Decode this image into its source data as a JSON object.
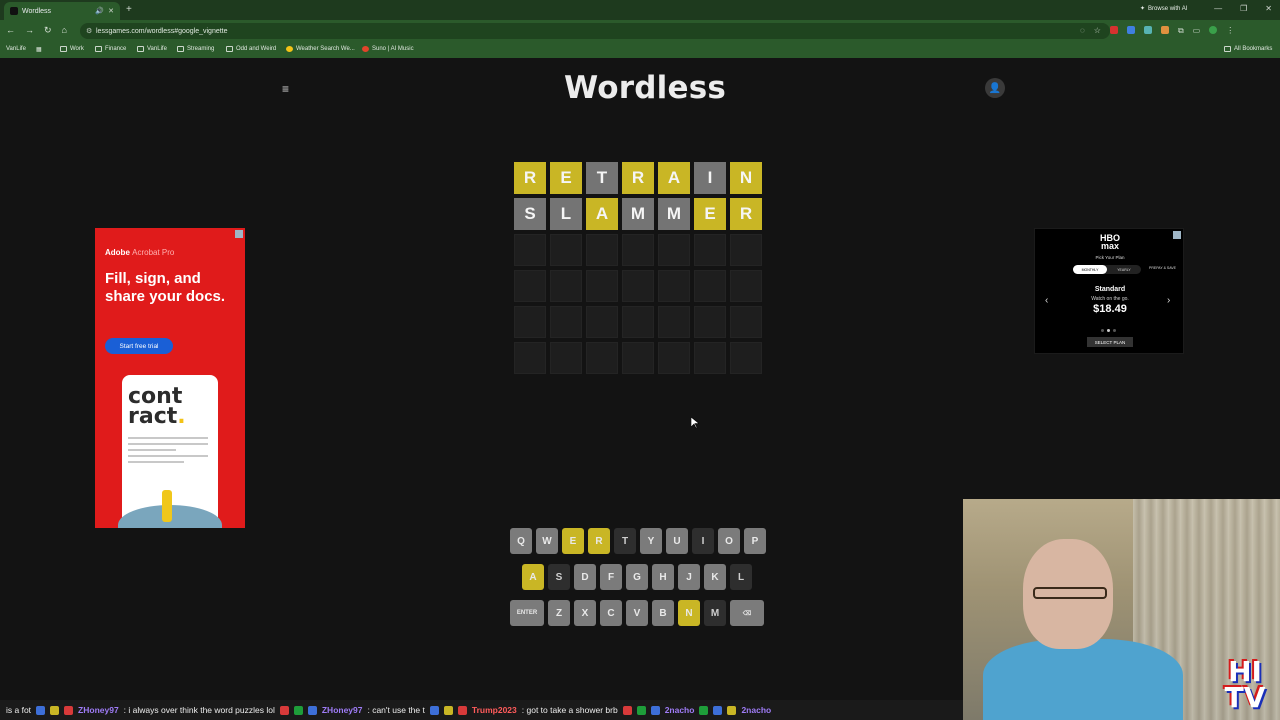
{
  "browser": {
    "tab_title": "Wordless",
    "url": "lessgames.com/wordless#google_vignette",
    "browse_ai": "Browse with AI",
    "bookmarks": [
      "VanLife",
      "Work",
      "Finance",
      "VanLife",
      "Streaming",
      "Odd and Weird",
      "Weather Search We...",
      "Suno | AI Music"
    ],
    "all_bookmarks": "All Bookmarks"
  },
  "game": {
    "title": "Wordless",
    "grid": [
      [
        {
          "l": "R",
          "s": "yellow"
        },
        {
          "l": "E",
          "s": "yellow"
        },
        {
          "l": "T",
          "s": "gray"
        },
        {
          "l": "R",
          "s": "yellow"
        },
        {
          "l": "A",
          "s": "yellow"
        },
        {
          "l": "I",
          "s": "gray"
        },
        {
          "l": "N",
          "s": "yellow"
        }
      ],
      [
        {
          "l": "S",
          "s": "gray"
        },
        {
          "l": "L",
          "s": "gray"
        },
        {
          "l": "A",
          "s": "yellow"
        },
        {
          "l": "M",
          "s": "gray"
        },
        {
          "l": "M",
          "s": "gray"
        },
        {
          "l": "E",
          "s": "yellow"
        },
        {
          "l": "R",
          "s": "yellow"
        }
      ],
      [
        {
          "l": "",
          "s": "empty"
        },
        {
          "l": "",
          "s": "empty"
        },
        {
          "l": "",
          "s": "empty"
        },
        {
          "l": "",
          "s": "empty"
        },
        {
          "l": "",
          "s": "empty"
        },
        {
          "l": "",
          "s": "empty"
        },
        {
          "l": "",
          "s": "empty"
        }
      ],
      [
        {
          "l": "",
          "s": "empty"
        },
        {
          "l": "",
          "s": "empty"
        },
        {
          "l": "",
          "s": "empty"
        },
        {
          "l": "",
          "s": "empty"
        },
        {
          "l": "",
          "s": "empty"
        },
        {
          "l": "",
          "s": "empty"
        },
        {
          "l": "",
          "s": "empty"
        }
      ],
      [
        {
          "l": "",
          "s": "empty"
        },
        {
          "l": "",
          "s": "empty"
        },
        {
          "l": "",
          "s": "empty"
        },
        {
          "l": "",
          "s": "empty"
        },
        {
          "l": "",
          "s": "empty"
        },
        {
          "l": "",
          "s": "empty"
        },
        {
          "l": "",
          "s": "empty"
        }
      ],
      [
        {
          "l": "",
          "s": "empty"
        },
        {
          "l": "",
          "s": "empty"
        },
        {
          "l": "",
          "s": "empty"
        },
        {
          "l": "",
          "s": "empty"
        },
        {
          "l": "",
          "s": "empty"
        },
        {
          "l": "",
          "s": "empty"
        },
        {
          "l": "",
          "s": "empty"
        }
      ]
    ],
    "keyboard": [
      [
        {
          "k": "Q",
          "s": "gray"
        },
        {
          "k": "W",
          "s": "gray"
        },
        {
          "k": "E",
          "s": "yellow"
        },
        {
          "k": "R",
          "s": "yellow"
        },
        {
          "k": "T",
          "s": "dark"
        },
        {
          "k": "Y",
          "s": "gray"
        },
        {
          "k": "U",
          "s": "gray"
        },
        {
          "k": "I",
          "s": "dark"
        },
        {
          "k": "O",
          "s": "gray"
        },
        {
          "k": "P",
          "s": "gray"
        }
      ],
      [
        {
          "k": "A",
          "s": "yellow"
        },
        {
          "k": "S",
          "s": "dark"
        },
        {
          "k": "D",
          "s": "gray"
        },
        {
          "k": "F",
          "s": "gray"
        },
        {
          "k": "G",
          "s": "gray"
        },
        {
          "k": "H",
          "s": "gray"
        },
        {
          "k": "J",
          "s": "gray"
        },
        {
          "k": "K",
          "s": "gray"
        },
        {
          "k": "L",
          "s": "dark"
        }
      ],
      [
        {
          "k": "ENTER",
          "s": "gray",
          "wide": true
        },
        {
          "k": "Z",
          "s": "gray"
        },
        {
          "k": "X",
          "s": "gray"
        },
        {
          "k": "C",
          "s": "gray"
        },
        {
          "k": "V",
          "s": "gray"
        },
        {
          "k": "B",
          "s": "gray"
        },
        {
          "k": "N",
          "s": "yellow"
        },
        {
          "k": "M",
          "s": "dark"
        },
        {
          "k": "⌫",
          "s": "gray",
          "wide": true
        }
      ]
    ]
  },
  "ad_left": {
    "brand": "Adobe",
    "product": "Acrobat Pro",
    "headline": "Fill, sign, and share your docs.",
    "cta": "Start free trial",
    "doc_word_1": "cont",
    "doc_word_2": "ract",
    "doc_dot": "."
  },
  "ad_right": {
    "brand_line1": "HBO",
    "brand_line2": "max",
    "pick": "Pick Your Plan",
    "monthly": "MONTHLY",
    "yearly": "YEARLY",
    "promo": "PREPAY & SAVE",
    "plan": "Standard",
    "plan_sub": "Watch on the go.",
    "price": "$18.49",
    "select": "SELECT PLAN"
  },
  "ticker": [
    {
      "t": "text",
      "v": "is a fot"
    },
    {
      "t": "user",
      "v": "ZHoney97"
    },
    {
      "t": "text",
      "v": ": i always over think the word puzzles lol"
    },
    {
      "t": "user",
      "v": "ZHoney97"
    },
    {
      "t": "text",
      "v": ": can't use the t"
    },
    {
      "t": "user_red",
      "v": "Trump2023"
    },
    {
      "t": "text",
      "v": ": got to take a shower brb"
    },
    {
      "t": "user",
      "v": "2nacho"
    },
    {
      "t": "user",
      "v": "2nacho"
    }
  ],
  "colors": {
    "yellow": "#c9b625",
    "gray": "#747474",
    "background": "#131313"
  }
}
